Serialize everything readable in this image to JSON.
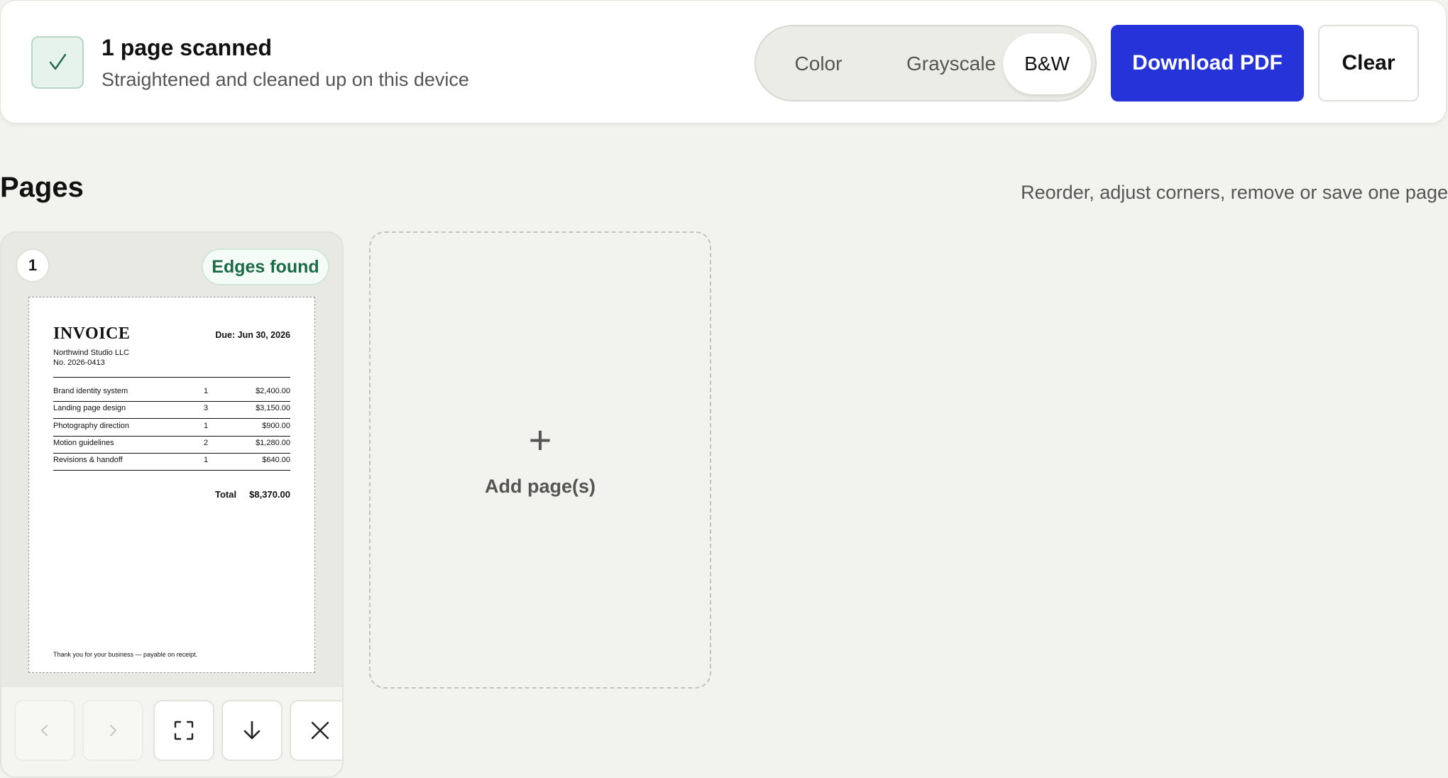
{
  "status": {
    "title": "1 page scanned",
    "subtitle": "Straightened and cleaned up on this device"
  },
  "modes": {
    "options": [
      "Color",
      "Grayscale",
      "B&W"
    ],
    "selected": "B&W"
  },
  "actions": {
    "download_label": "Download PDF",
    "clear_label": "Clear"
  },
  "pages": {
    "title": "Pages",
    "hint": "Reorder, adjust corners, remove or save one page",
    "add_label": "Add page(s)",
    "add_symbol": "+",
    "items": [
      {
        "number": "1",
        "badge": "Edges found",
        "document": {
          "title": "INVOICE",
          "due": "Due: Jun 30, 2026",
          "company": "Northwind Studio LLC",
          "number": "No. 2026-0413",
          "lines": [
            {
              "desc": "Brand identity system",
              "qty": "1",
              "amount": "$2,400.00"
            },
            {
              "desc": "Landing page design",
              "qty": "3",
              "amount": "$3,150.00"
            },
            {
              "desc": "Photography direction",
              "qty": "1",
              "amount": "$900.00"
            },
            {
              "desc": "Motion guidelines",
              "qty": "2",
              "amount": "$1,280.00"
            },
            {
              "desc": "Revisions & handoff",
              "qty": "1",
              "amount": "$640.00"
            }
          ],
          "total_label": "Total",
          "total_value": "$8,370.00",
          "footer": "Thank you for your business — payable on receipt."
        },
        "tools": [
          "chevron-left-icon",
          "chevron-right-icon",
          "adjust-corners-icon",
          "download-icon",
          "close-icon"
        ]
      }
    ]
  },
  "colors": {
    "accent": "#2633d8",
    "success": "#1b6b45",
    "background": "#f2f2ee"
  }
}
